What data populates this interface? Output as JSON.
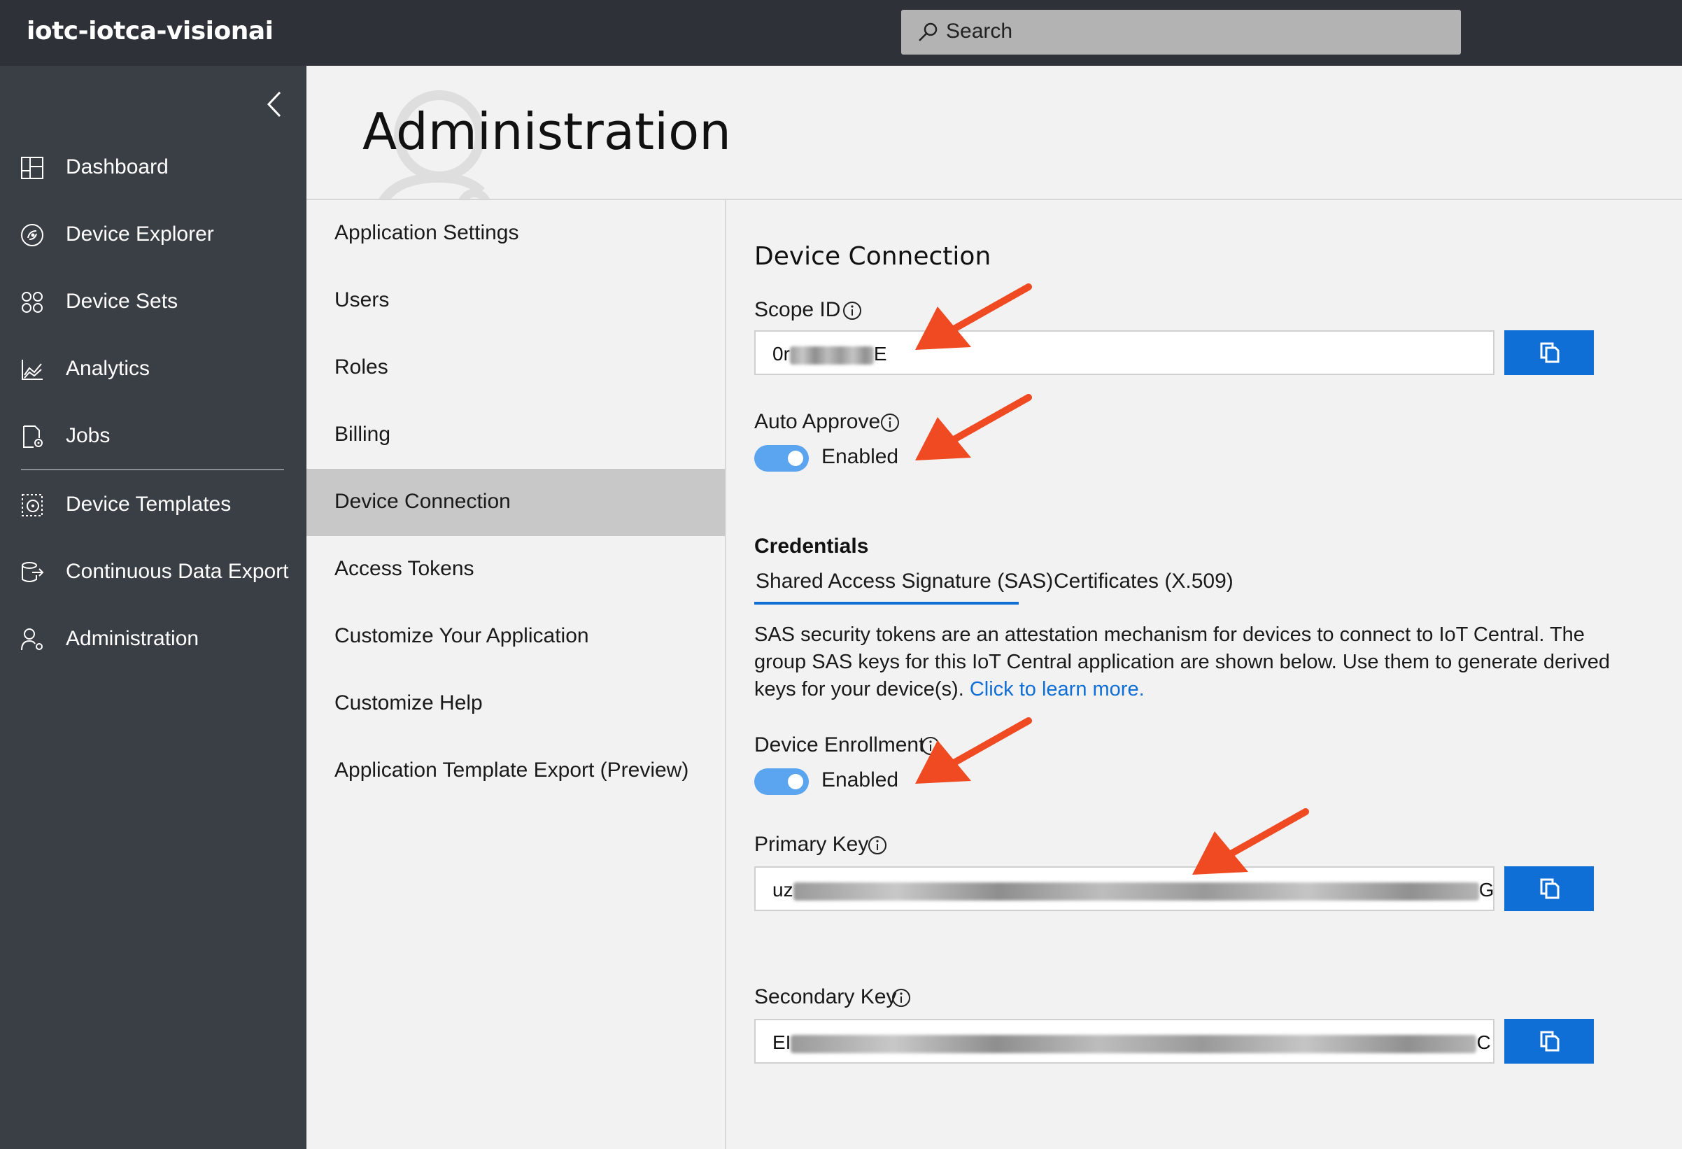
{
  "app": {
    "title": "iotc-iotca-visionai"
  },
  "search": {
    "label": "Search"
  },
  "sidebar": {
    "items": [
      {
        "label": "Dashboard",
        "icon": "dashboard-icon"
      },
      {
        "label": "Device Explorer",
        "icon": "device-explorer-icon"
      },
      {
        "label": "Device Sets",
        "icon": "device-sets-icon"
      },
      {
        "label": "Analytics",
        "icon": "analytics-icon"
      },
      {
        "label": "Jobs",
        "icon": "jobs-icon"
      },
      {
        "label": "Device Templates",
        "icon": "device-templates-icon"
      },
      {
        "label": "Continuous Data Export",
        "icon": "data-export-icon"
      },
      {
        "label": "Administration",
        "icon": "administration-icon"
      }
    ]
  },
  "page": {
    "title": "Administration"
  },
  "subnav": {
    "items": [
      {
        "label": "Application Settings"
      },
      {
        "label": "Users"
      },
      {
        "label": "Roles"
      },
      {
        "label": "Billing"
      },
      {
        "label": "Device Connection",
        "active": true
      },
      {
        "label": "Access Tokens"
      },
      {
        "label": "Customize Your Application"
      },
      {
        "label": "Customize Help"
      },
      {
        "label": "Application Template Export (Preview)"
      }
    ]
  },
  "device_connection": {
    "title": "Device Connection",
    "scope_id": {
      "label": "Scope ID",
      "value_start": "0r",
      "value_end": "E"
    },
    "auto_approve": {
      "label": "Auto Approve",
      "state": "Enabled",
      "on": true
    },
    "credentials": {
      "title": "Credentials",
      "tabs": [
        {
          "label": "Shared Access Signature (SAS)",
          "selected": true
        },
        {
          "label": "Certificates (X.509)",
          "selected": false
        }
      ],
      "description": "SAS security tokens are an attestation mechanism for devices to connect to IoT Central. The group SAS keys for this IoT Central application are shown below. Use them to generate derived keys for your device(s).",
      "link": "Click to learn more."
    },
    "device_enrollment": {
      "label": "Device Enrollment",
      "state": "Enabled",
      "on": true
    },
    "primary_key": {
      "label": "Primary Key",
      "value_start": "uz",
      "value_end": "G"
    },
    "secondary_key": {
      "label": "Secondary Key",
      "value_start": "EI",
      "value_end": "C"
    }
  },
  "colors": {
    "accent": "#0f6fd6",
    "toggle": "#5ba4ef",
    "arrow": "#f04a23",
    "topbar": "#2e3238",
    "sidebar": "#3a3e45"
  }
}
